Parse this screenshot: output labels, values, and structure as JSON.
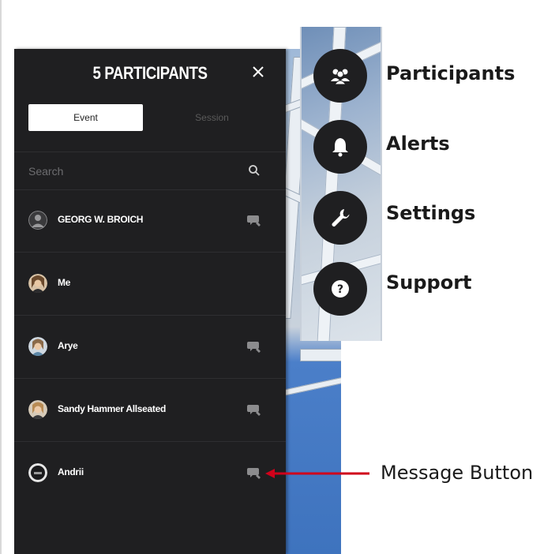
{
  "panel": {
    "title": "5 PARTICIPANTS",
    "close_icon": "close-icon",
    "tabs": [
      {
        "label": "Event",
        "selected": true
      },
      {
        "label": "Session",
        "selected": false
      }
    ],
    "search": {
      "placeholder": "Search",
      "icon": "search-icon"
    },
    "participants": [
      {
        "name": "GEORG W. BROICH",
        "avatar": "avatar-placeholder",
        "has_message_button": true
      },
      {
        "name": "Me",
        "avatar": "avatar-photo",
        "has_message_button": false
      },
      {
        "name": "Arye",
        "avatar": "avatar-photo",
        "has_message_button": true
      },
      {
        "name": "Sandy Hammer Allseated",
        "avatar": "avatar-photo",
        "has_message_button": true
      },
      {
        "name": "Andrii",
        "avatar": "avatar-photo",
        "has_message_button": true
      }
    ],
    "message_icon": "chat-bubble-icon"
  },
  "toolbar": {
    "items": [
      {
        "label": "Participants",
        "icon": "participants-icon"
      },
      {
        "label": "Alerts",
        "icon": "bell-icon"
      },
      {
        "label": "Settings",
        "icon": "wrench-icon"
      },
      {
        "label": "Support",
        "icon": "question-icon"
      }
    ]
  },
  "callout": {
    "label": "Message Button",
    "arrow_color": "#d0021b"
  },
  "colors": {
    "panel_bg": "#1f1f21",
    "tab_selected_bg": "#ffffff",
    "text_primary": "#ffffff",
    "label_text": "#1a1a1a"
  }
}
